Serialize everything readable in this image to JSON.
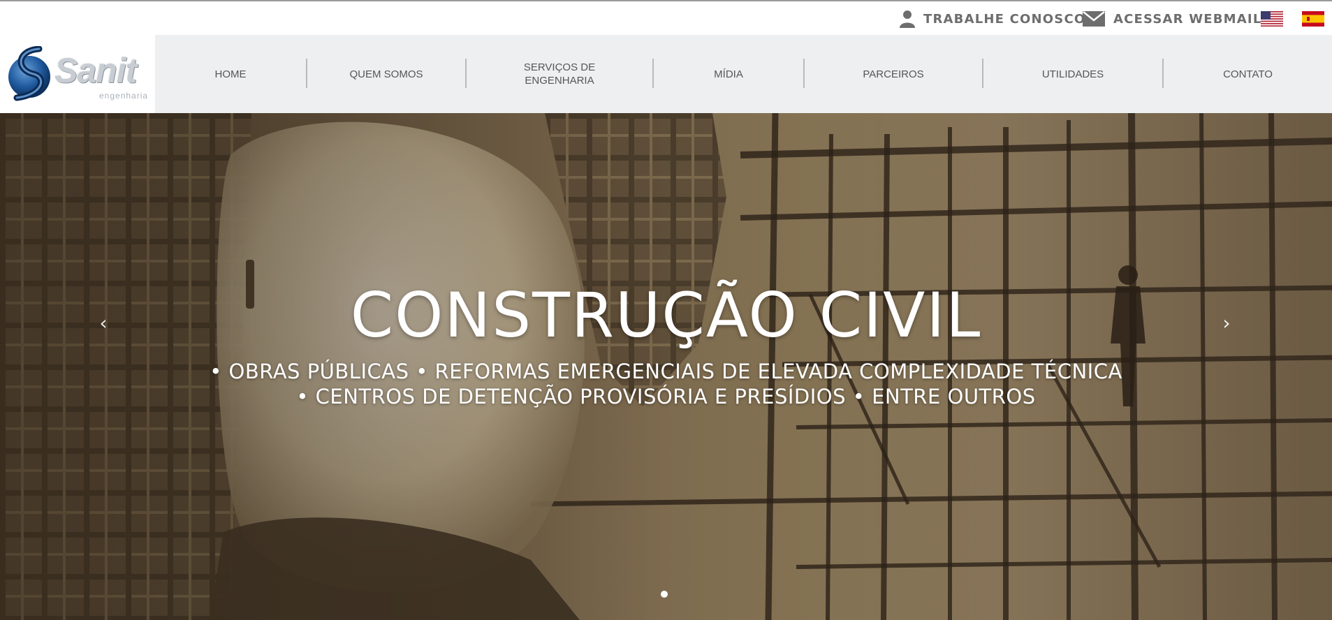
{
  "topbar": {
    "work_link": "TRABALHE CONOSCO",
    "webmail_link": "ACESSAR WEBMAIL",
    "icons": {
      "work": "user-icon",
      "webmail": "envelope-icon"
    },
    "flags": [
      "us-flag-icon",
      "spain-flag-icon"
    ]
  },
  "logo": {
    "name": "Sanit",
    "sub": "engenharia"
  },
  "nav": {
    "items": [
      {
        "label": "HOME"
      },
      {
        "label": "QUEM SOMOS"
      },
      {
        "label": "SERVIÇOS DE\nENGENHARIA"
      },
      {
        "label": "MÍDIA"
      },
      {
        "label": "PARCEIROS"
      },
      {
        "label": "UTILIDADES"
      },
      {
        "label": "CONTATO"
      }
    ]
  },
  "hero": {
    "title": "CONSTRUÇÃO CIVIL",
    "line1": "• OBRAS PÚBLICAS • REFORMAS EMERGENCIAIS DE ELEVADA COMPLEXIDADE TÉCNICA",
    "line2": "• CENTROS DE DETENÇÃO PROVISÓRIA E PRESÍDIOS • ENTRE OUTROS",
    "prev": "‹",
    "next": "›",
    "slide_count": 1,
    "active_slide": 1
  },
  "colors": {
    "nav_bg": "#eeeff0",
    "nav_text": "#555555",
    "topbar_text": "#6d6d6d",
    "hero_tone": "#8a7658"
  }
}
